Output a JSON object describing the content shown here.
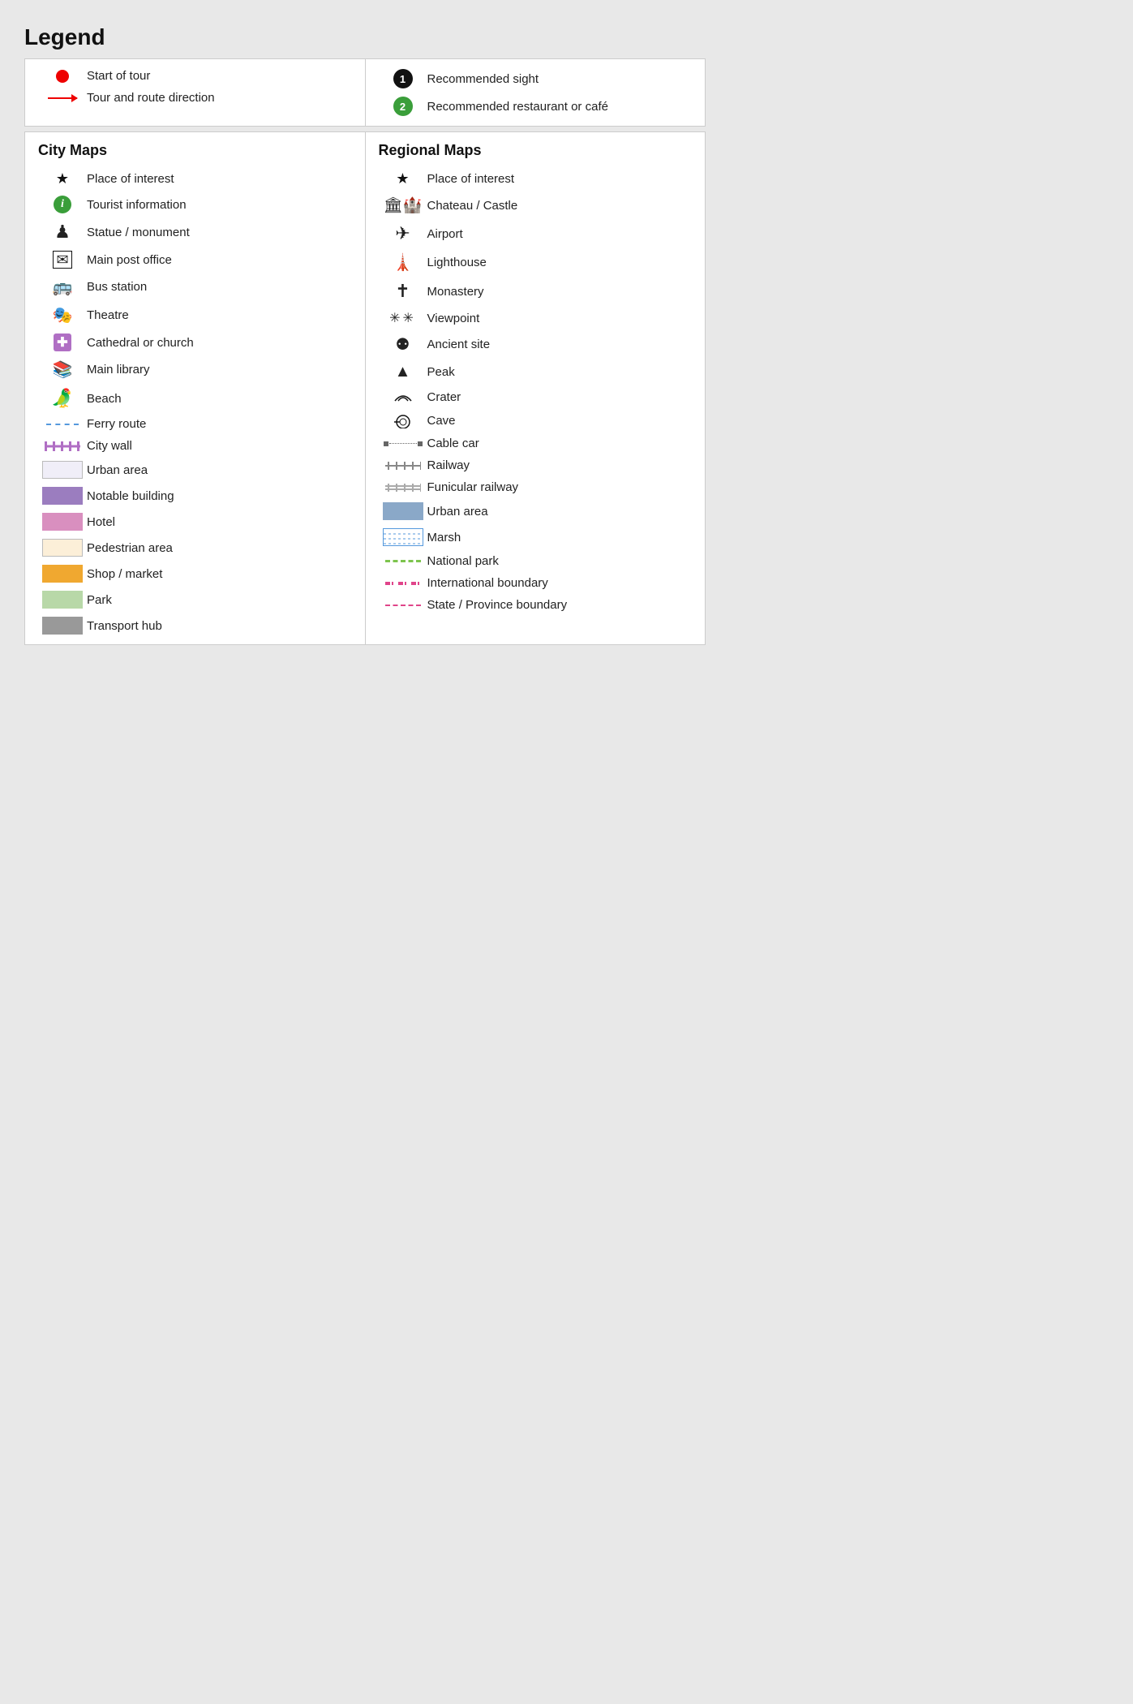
{
  "title": "Legend",
  "top_section": {
    "left": [
      {
        "icon_type": "red-dot",
        "label": "Start of tour"
      },
      {
        "icon_type": "red-arrow",
        "label": "Tour and route direction"
      }
    ],
    "right": [
      {
        "icon_type": "circle-1",
        "label": "Recommended sight"
      },
      {
        "icon_type": "circle-2",
        "label": "Recommended restaurant or café"
      }
    ]
  },
  "city_maps": {
    "title": "City Maps",
    "items": [
      {
        "icon_type": "star",
        "label": "Place of interest"
      },
      {
        "icon_type": "info-green",
        "label": "Tourist information"
      },
      {
        "icon_type": "statue",
        "label": "Statue / monument"
      },
      {
        "icon_type": "post",
        "label": "Main post office"
      },
      {
        "icon_type": "bus",
        "label": "Bus station"
      },
      {
        "icon_type": "theatre",
        "label": "Theatre"
      },
      {
        "icon_type": "church",
        "label": "Cathedral or church"
      },
      {
        "icon_type": "library",
        "label": "Main library"
      },
      {
        "icon_type": "beach",
        "label": "Beach"
      },
      {
        "icon_type": "ferry",
        "label": "Ferry route"
      },
      {
        "icon_type": "city-wall",
        "label": "City wall"
      },
      {
        "icon_type": "urban-box",
        "label": "Urban area"
      },
      {
        "icon_type": "notable-box",
        "label": "Notable building"
      },
      {
        "icon_type": "hotel-box",
        "label": "Hotel"
      },
      {
        "icon_type": "pedestrian-box",
        "label": "Pedestrian area"
      },
      {
        "icon_type": "shop-box",
        "label": "Shop / market"
      },
      {
        "icon_type": "park-box",
        "label": "Park"
      },
      {
        "icon_type": "transport-box",
        "label": "Transport hub"
      }
    ]
  },
  "regional_maps": {
    "title": "Regional Maps",
    "items": [
      {
        "icon_type": "star",
        "label": "Place of interest"
      },
      {
        "icon_type": "castle",
        "label": "Chateau / Castle"
      },
      {
        "icon_type": "airport",
        "label": "Airport"
      },
      {
        "icon_type": "lighthouse",
        "label": "Lighthouse"
      },
      {
        "icon_type": "monastery",
        "label": "Monastery"
      },
      {
        "icon_type": "viewpoint",
        "label": "Viewpoint"
      },
      {
        "icon_type": "ancient",
        "label": "Ancient site"
      },
      {
        "icon_type": "peak",
        "label": "Peak"
      },
      {
        "icon_type": "crater",
        "label": "Crater"
      },
      {
        "icon_type": "cave",
        "label": "Cave"
      },
      {
        "icon_type": "cable-car",
        "label": "Cable car"
      },
      {
        "icon_type": "railway",
        "label": "Railway"
      },
      {
        "icon_type": "funicular",
        "label": "Funicular railway"
      },
      {
        "icon_type": "urban-blue",
        "label": "Urban area"
      },
      {
        "icon_type": "marsh",
        "label": "Marsh"
      },
      {
        "icon_type": "national-park",
        "label": "National park"
      },
      {
        "icon_type": "intl-boundary",
        "label": "International boundary"
      },
      {
        "icon_type": "state-boundary",
        "label": "State / Province boundary"
      }
    ]
  }
}
